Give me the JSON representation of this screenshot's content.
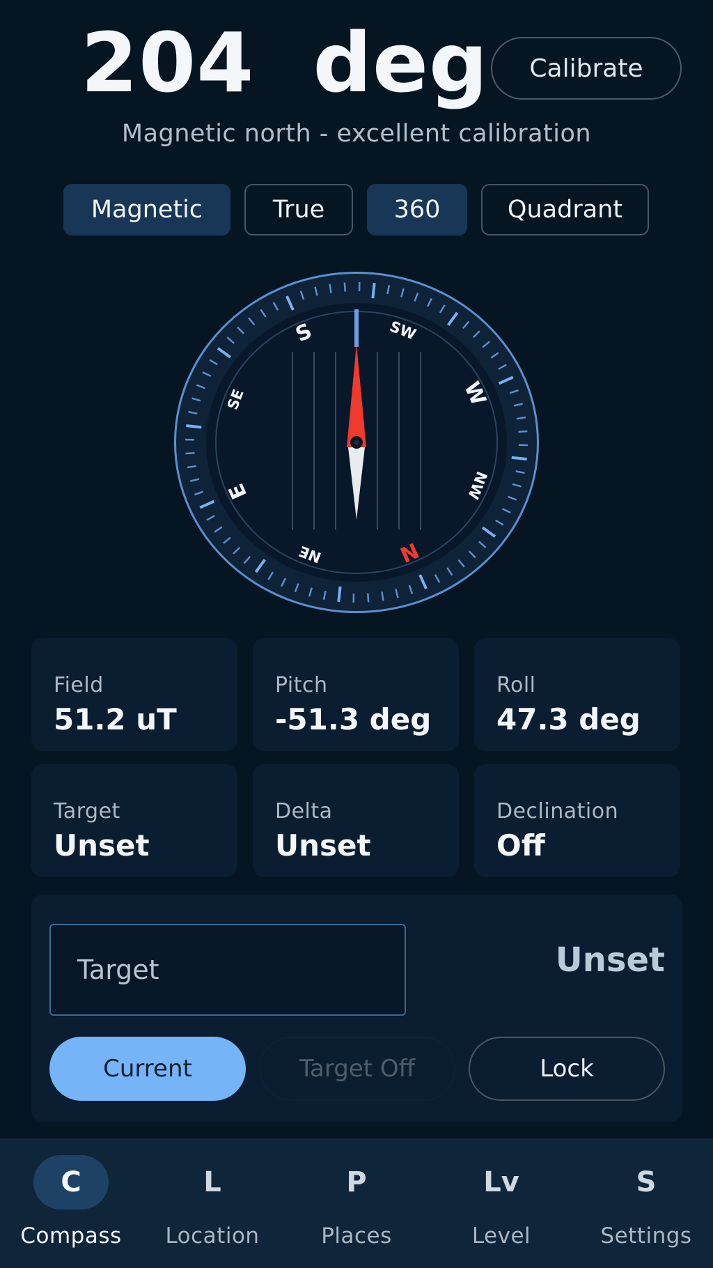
{
  "header": {
    "heading_value": "204  deg",
    "calibrate_label": "Calibrate",
    "subtitle": "Magnetic north - excellent calibration"
  },
  "modes": [
    {
      "label": "Magnetic",
      "active": true
    },
    {
      "label": "True",
      "active": false
    },
    {
      "label": "360",
      "active": true
    },
    {
      "label": "Quadrant",
      "active": false
    }
  ],
  "compass": {
    "heading_deg": 204,
    "cardinals": {
      "N": "N",
      "E": "E",
      "S": "S",
      "W": "W"
    },
    "intercardinals": {
      "NE": "NE",
      "SE": "SE",
      "SW": "SW",
      "NW": "NW"
    },
    "colors": {
      "north": "#f03a2e",
      "needle_north": "#f03a2e",
      "needle_south": "#e8ecef",
      "ring": "#5b8fd0",
      "accent_tick": "#7ab0ee"
    }
  },
  "stats": [
    {
      "label": "Field",
      "value": "51.2 uT"
    },
    {
      "label": "Pitch",
      "value": "-51.3 deg"
    },
    {
      "label": "Roll",
      "value": "47.3 deg"
    },
    {
      "label": "Target",
      "value": "Unset"
    },
    {
      "label": "Delta",
      "value": "Unset"
    },
    {
      "label": "Declination",
      "value": "Off"
    }
  ],
  "target": {
    "input_placeholder": "Target",
    "input_value": "",
    "status": "Unset",
    "current_label": "Current",
    "target_off_label": "Target Off",
    "lock_label": "Lock"
  },
  "nav": [
    {
      "icon": "C",
      "label": "Compass",
      "active": true
    },
    {
      "icon": "L",
      "label": "Location",
      "active": false
    },
    {
      "icon": "P",
      "label": "Places",
      "active": false
    },
    {
      "icon": "Lv",
      "label": "Level",
      "active": false
    },
    {
      "icon": "S",
      "label": "Settings",
      "active": false
    }
  ]
}
